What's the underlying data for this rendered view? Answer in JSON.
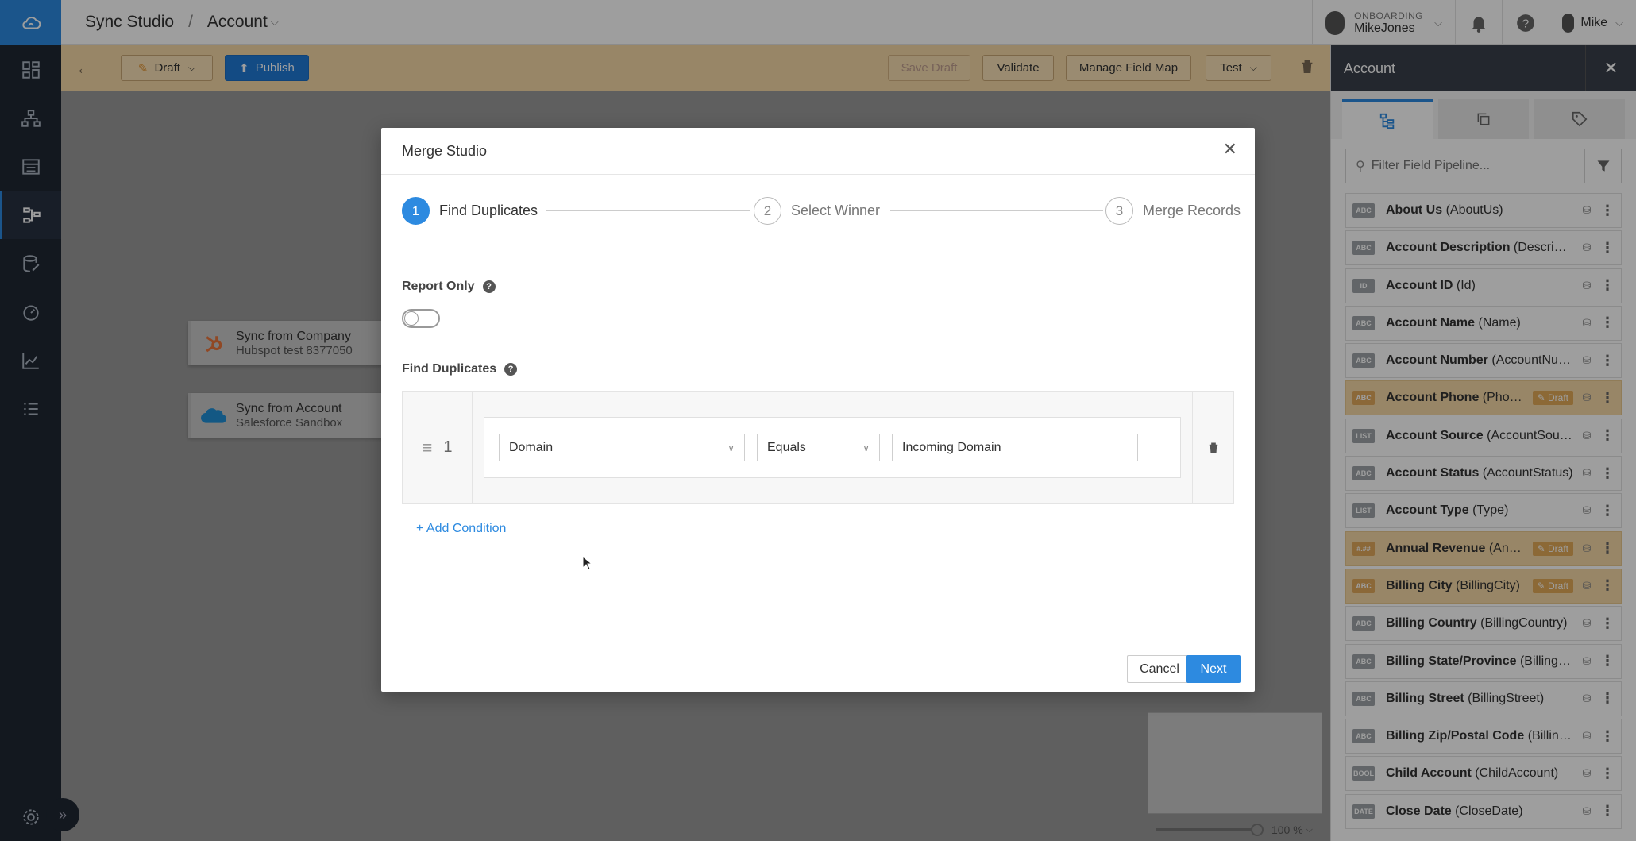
{
  "topbar": {
    "breadcrumb_root": "Sync Studio",
    "breadcrumb_sep": "/",
    "breadcrumb_current": "Account",
    "onboarding_label": "ONBOARDING",
    "onboarding_user": "MikeJones",
    "user_name": "Mike"
  },
  "toolbar": {
    "draft_label": "Draft",
    "publish_label": "Publish",
    "save_draft_label": "Save Draft",
    "validate_label": "Validate",
    "manage_field_map_label": "Manage Field Map",
    "test_label": "Test"
  },
  "canvas": {
    "nodes": [
      {
        "title": "Sync from  Company",
        "subtitle": "Hubspot test 8377050"
      },
      {
        "title": "Sync from  Account",
        "subtitle": "Salesforce Sandbox"
      }
    ],
    "zoom_label": "100 %"
  },
  "right_panel": {
    "title": "Account",
    "search_placeholder": "Filter Field Pipeline...",
    "items": [
      {
        "badge": "ABC",
        "name": "About Us",
        "api": "(AboutUs)",
        "draft": false
      },
      {
        "badge": "ABC",
        "name": "Account Description",
        "api": "(Descripti...",
        "draft": false
      },
      {
        "badge": "ID",
        "name": "Account ID",
        "api": "(Id)",
        "draft": false
      },
      {
        "badge": "ABC",
        "name": "Account Name",
        "api": "(Name)",
        "draft": false
      },
      {
        "badge": "ABC",
        "name": "Account Number",
        "api": "(AccountNum...",
        "draft": false
      },
      {
        "badge": "ABC",
        "name": "Account Phone",
        "api": "(Phone)",
        "draft": true
      },
      {
        "badge": "LIST",
        "name": "Account Source",
        "api": "(AccountSource)",
        "draft": false
      },
      {
        "badge": "ABC",
        "name": "Account Status",
        "api": "(AccountStatus)",
        "draft": false
      },
      {
        "badge": "LIST",
        "name": "Account Type",
        "api": "(Type)",
        "draft": false
      },
      {
        "badge": "#.##",
        "name": "Annual Revenue",
        "api": "(Annual...",
        "draft": true
      },
      {
        "badge": "ABC",
        "name": "Billing City",
        "api": "(BillingCity)",
        "draft": true
      },
      {
        "badge": "ABC",
        "name": "Billing Country",
        "api": "(BillingCountry)",
        "draft": false
      },
      {
        "badge": "ABC",
        "name": "Billing State/Province",
        "api": "(BillingSt...",
        "draft": false
      },
      {
        "badge": "ABC",
        "name": "Billing Street",
        "api": "(BillingStreet)",
        "draft": false
      },
      {
        "badge": "ABC",
        "name": "Billing Zip/Postal Code",
        "api": "(BillingP...",
        "draft": false
      },
      {
        "badge": "BOOL",
        "name": "Child Account",
        "api": "(ChildAccount)",
        "draft": false
      },
      {
        "badge": "DATE",
        "name": "Close Date",
        "api": "(CloseDate)",
        "draft": false
      }
    ],
    "draft_tag": "Draft"
  },
  "modal": {
    "title": "Merge Studio",
    "steps": [
      {
        "num": "1",
        "label": "Find Duplicates"
      },
      {
        "num": "2",
        "label": "Select Winner"
      },
      {
        "num": "3",
        "label": "Merge Records"
      }
    ],
    "report_only_label": "Report Only",
    "find_duplicates_label": "Find Duplicates",
    "condition": {
      "index": "1",
      "field": "Domain",
      "operator": "Equals",
      "value": "Incoming Domain"
    },
    "add_condition_label": "+ Add Condition",
    "cancel_label": "Cancel",
    "next_label": "Next"
  },
  "colors": {
    "accent": "#2d8ae0",
    "draft_bg": "#f6d8a6",
    "nav_bg": "#1f2733"
  }
}
